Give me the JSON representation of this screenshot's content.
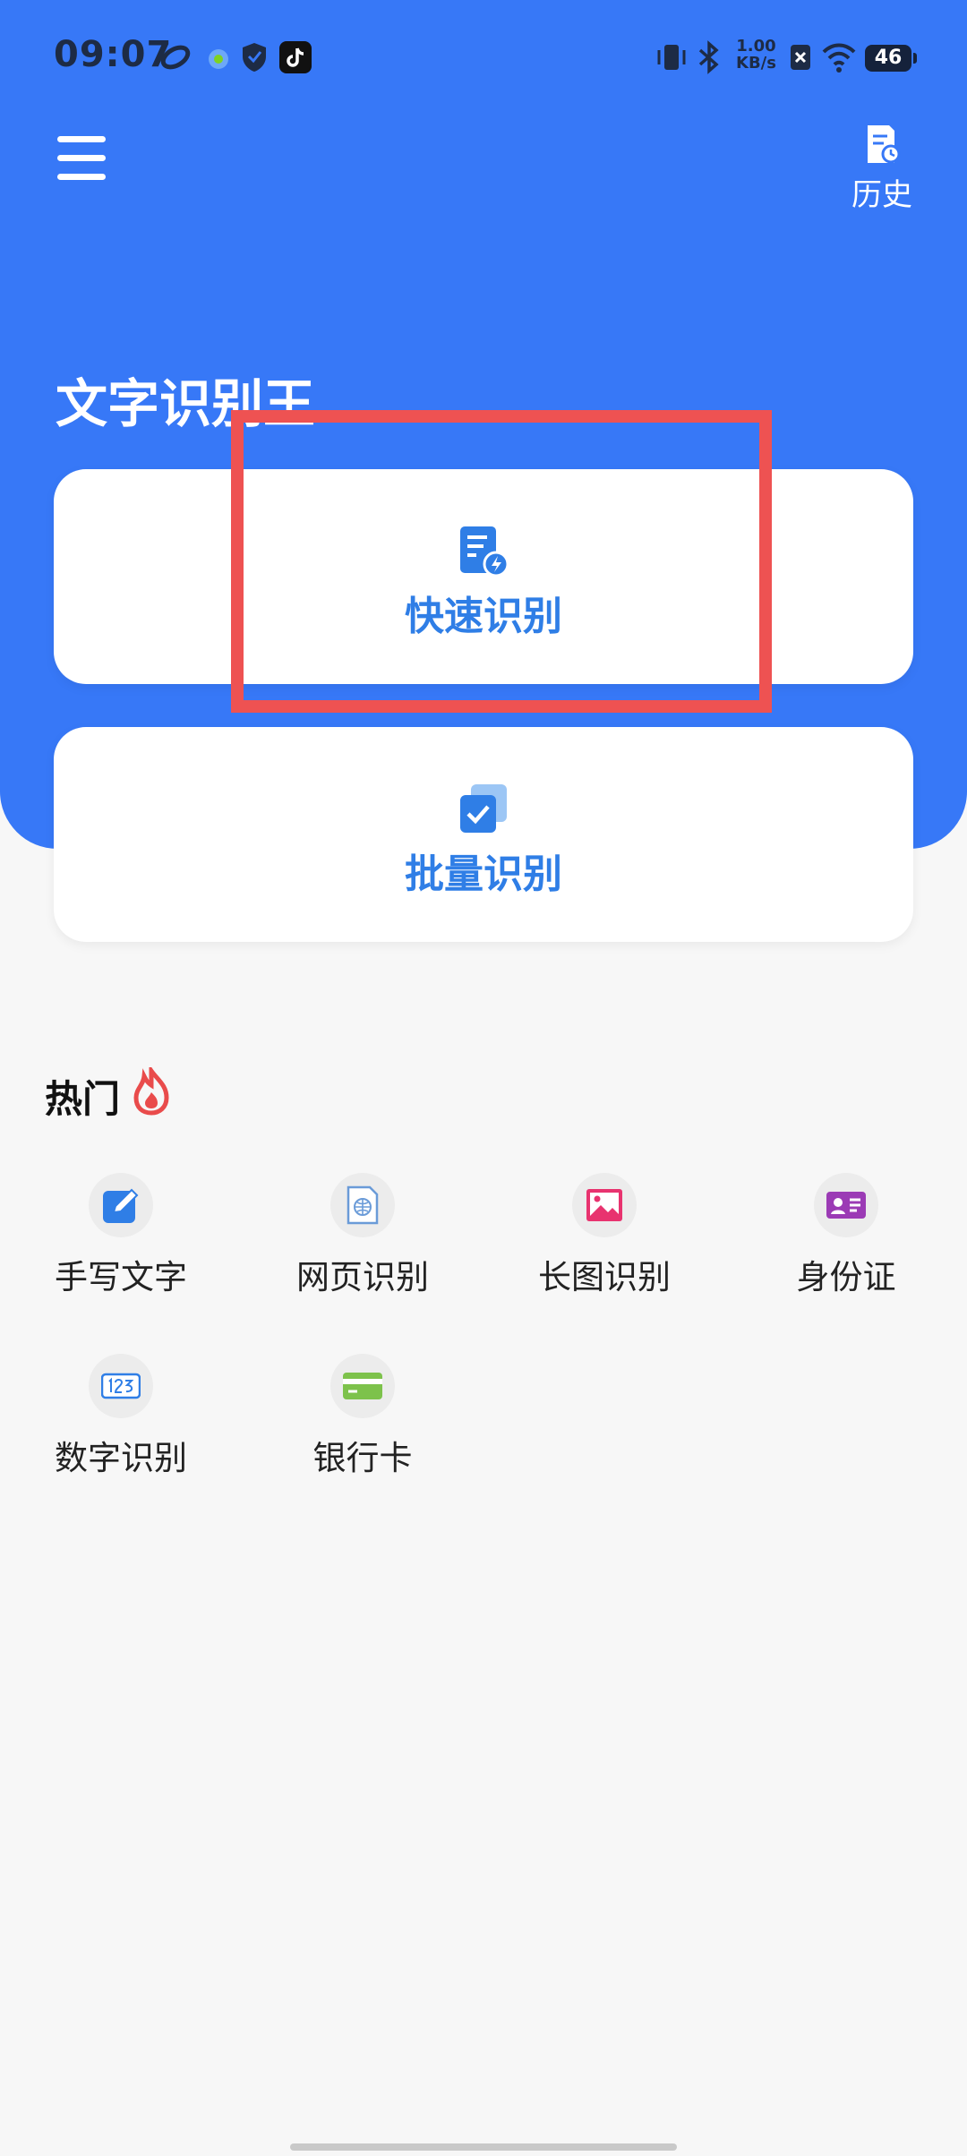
{
  "status_bar": {
    "time": "09:07",
    "net_speed_value": "1.00",
    "net_speed_unit": "KB/s",
    "battery": "46"
  },
  "header": {
    "history_label": "历史",
    "app_title": "文字识别王"
  },
  "main_actions": [
    {
      "label": "快速识别",
      "icon": "quick-scan-icon"
    },
    {
      "label": "批量识别",
      "icon": "batch-scan-icon"
    }
  ],
  "hot_section": {
    "title": "热门",
    "items": [
      {
        "label": "手写文字",
        "icon": "handwriting-icon"
      },
      {
        "label": "网页识别",
        "icon": "webpage-icon"
      },
      {
        "label": "长图识别",
        "icon": "long-image-icon"
      },
      {
        "label": "身份证",
        "icon": "id-card-icon"
      },
      {
        "label": "数字识别",
        "icon": "number-icon"
      },
      {
        "label": "银行卡",
        "icon": "bank-card-icon"
      }
    ]
  },
  "colors": {
    "primary": "#3778f7",
    "accent_text": "#2f7ee6",
    "highlight": "#ee5252"
  }
}
